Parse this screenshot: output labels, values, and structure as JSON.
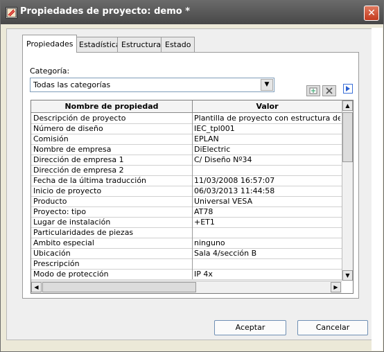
{
  "window": {
    "title": "Propiedades de proyecto: demo *",
    "close_glyph": "✕",
    "title_icon": "project-properties-icon"
  },
  "tabs": [
    {
      "label": "Propiedades",
      "active": true
    },
    {
      "label": "Estadística",
      "active": false
    },
    {
      "label": "Estructura",
      "active": false
    },
    {
      "label": "Estado",
      "active": false
    }
  ],
  "category": {
    "label": "Categoría:",
    "value": "Todas las categorías",
    "dropdown_glyph": "▼"
  },
  "toolbar_icons": [
    "new-property-icon",
    "delete-property-icon",
    "execute-icon"
  ],
  "table": {
    "columns": [
      "Nombre de propiedad",
      "Valor"
    ],
    "rows": [
      {
        "name": "Descripción de proyecto",
        "value": "Plantilla de proyecto con estructura de ide.."
      },
      {
        "name": "Número de diseño",
        "value": "IEC_tpl001"
      },
      {
        "name": "Comisión",
        "value": "EPLAN"
      },
      {
        "name": "Nombre de empresa",
        "value": "DiElectric"
      },
      {
        "name": "Dirección de empresa 1",
        "value": "C/ Diseño Nº34"
      },
      {
        "name": "Dirección de empresa 2",
        "value": ""
      },
      {
        "name": "Fecha de la última traducción",
        "value": "11/03/2008 16:57:07"
      },
      {
        "name": "Inicio de proyecto",
        "value": "06/03/2013 11:44:58"
      },
      {
        "name": "Producto",
        "value": "Universal VESA"
      },
      {
        "name": "Proyecto: tipo",
        "value": "AT78"
      },
      {
        "name": "Lugar de instalación",
        "value": "+ET1"
      },
      {
        "name": "Particularidades de piezas",
        "value": ""
      },
      {
        "name": "Ambito especial",
        "value": "ninguno"
      },
      {
        "name": "Ubicación",
        "value": "Sala 4/sección B"
      },
      {
        "name": "Prescripción",
        "value": ""
      },
      {
        "name": "Modo de protección",
        "value": "IP 4x"
      }
    ]
  },
  "buttons": {
    "accept": "Aceptar",
    "cancel": "Cancelar"
  }
}
